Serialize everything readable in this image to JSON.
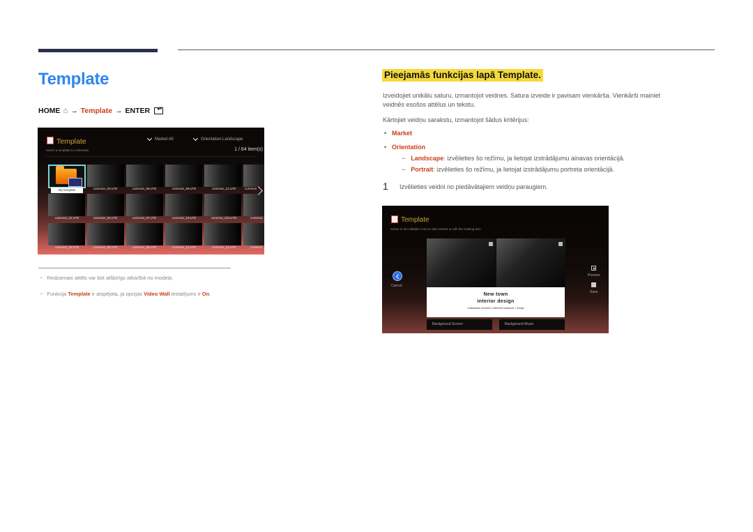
{
  "page": {
    "title": "Template",
    "breadcrumb": {
      "home": "HOME",
      "home_icon": "home-icon",
      "arrow1": "→",
      "item": "Template",
      "arrow2": "→",
      "enter": "ENTER",
      "enter_icon": "enter-icon"
    }
  },
  "screenshot_list": {
    "title": "Template",
    "subtitle": "Select a template to customise.",
    "filter_market": "Market:All",
    "filter_orientation": "Orientation:Landscape",
    "count": "1 / 64 item(s)",
    "selected_label": "My template",
    "row1": [
      "common_03.LFD",
      "common_06.LFD",
      "common_09.LFD",
      "common_12.LFD",
      "common"
    ],
    "row2": [
      "common_01.LFD",
      "common_04.LFD",
      "common_07.LFD",
      "common_10.LFD",
      "common_013.LFD",
      "common"
    ],
    "row3": [
      "common_02.LFD",
      "common_05.LFD",
      "common_08.LFD",
      "common_11.LFD",
      "common_14.LFD",
      "common"
    ]
  },
  "notes": [
    {
      "dash": "−",
      "text": "Redzamais attēls var būt atšķirīgs atkarībā no modeļa."
    },
    {
      "dash": "−",
      "pre": "Funkcija ",
      "b1": "Template",
      "mid1": " ir atspējota, ja opcijas ",
      "b2": "Video Wall",
      "mid2": " iestatījums ir ",
      "b3": "On",
      "post": "."
    }
  ],
  "section": {
    "title": "Pieejamās funkcijas lapā Template.",
    "intro_line1": "Izveidojiet unikālu saturu, izmantojot veidnes. Satura izveide ir pavisam vienkārša. Vienkārši mainiet",
    "intro_line2": "veidnēs esošos attēlus un tekstu.",
    "sort_intro": "Kārtojiet veidņu sarakstu, izmantojot šādus kritērijus:",
    "bullets": [
      "Market",
      "Orientation"
    ],
    "bullet_dot": "•",
    "sub_items": [
      {
        "dash": "−",
        "label": "Landscape",
        "text": ": izvēlieties šo režīmu, ja lietojat izstrādājumu ainavas orientācijā."
      },
      {
        "dash": "−",
        "label": "Portrait",
        "text": ":    izvēlieties šo režīmu, ja lietojat izstrādājumu portreta orientācijā."
      }
    ],
    "step_number": "1",
    "step_text": "Izvēlieties veidni no piedāvātajiem veidņu paraugiem."
  },
  "screenshot_editor": {
    "title": "Template",
    "subtitle": "Select in the editable zone to add content or edit the existing text.",
    "text_line1": "New town",
    "text_line2": "interior design",
    "text_line3": "Sustainable revolution unfinished treasures + design",
    "cancel_label": "Cancel",
    "preview_label": "Preview",
    "save_label": "Save",
    "btn_background_screen": "Background Screen",
    "btn_background_music": "Background Music"
  }
}
